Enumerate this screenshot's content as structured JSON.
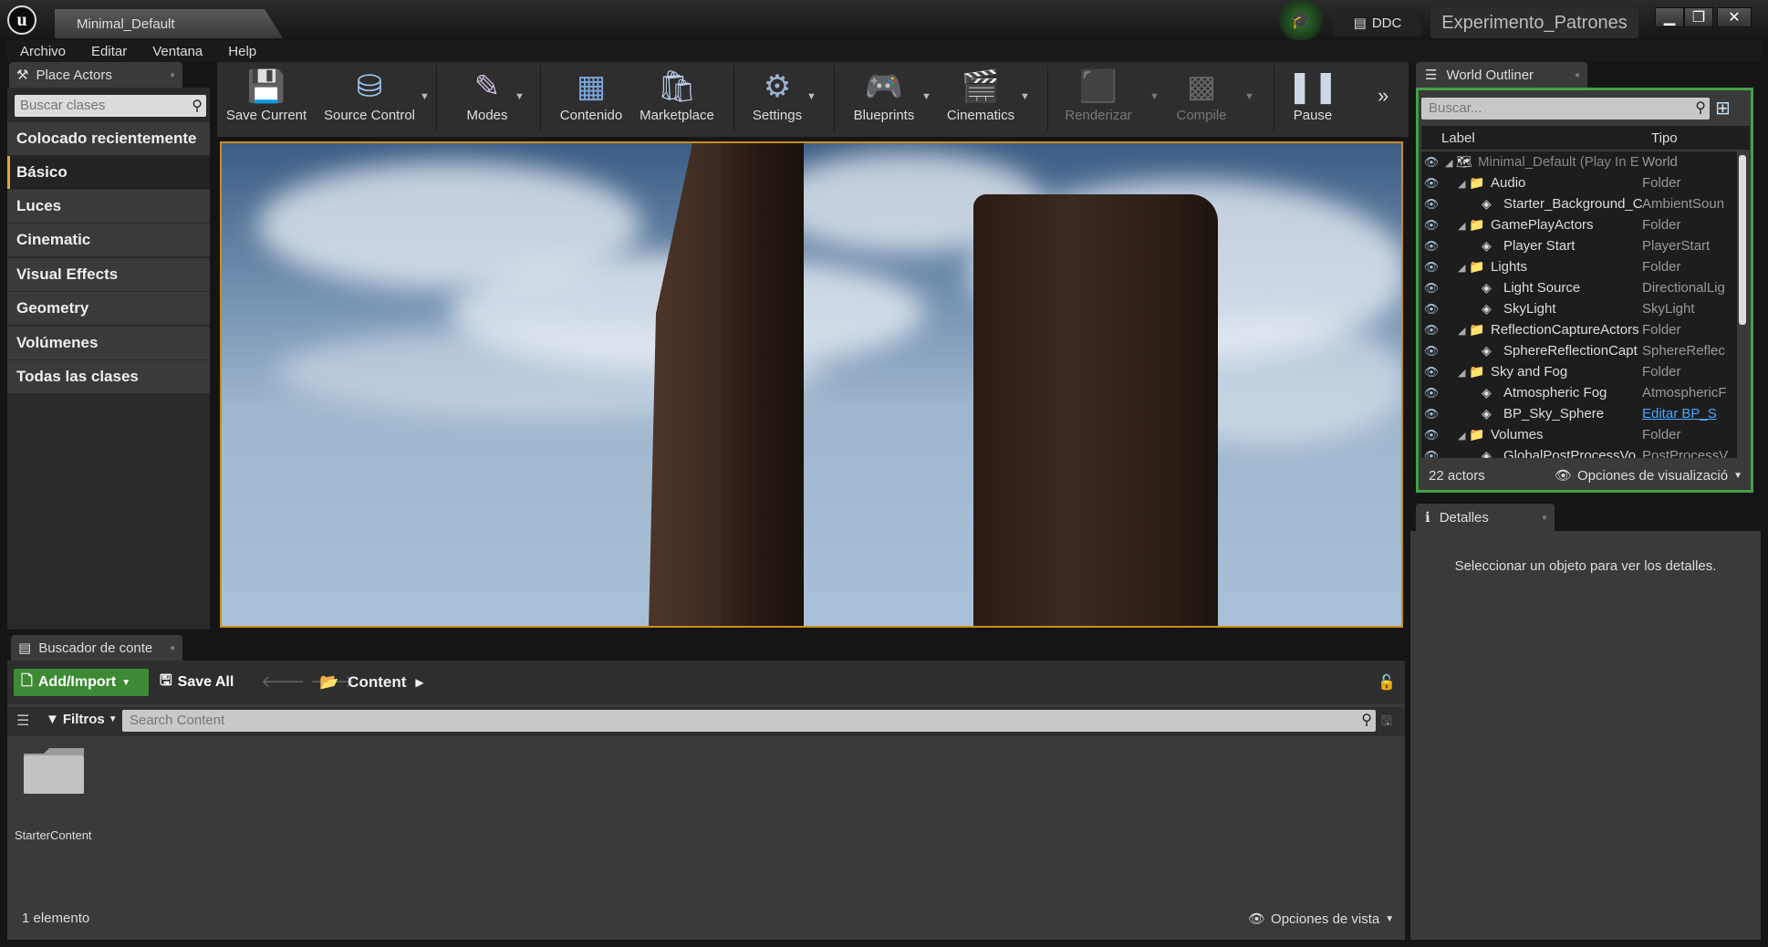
{
  "window": {
    "level_tab": "Minimal_Default",
    "ddc_label": "DDC",
    "project_name": "Experimento_Patrones",
    "tutorial_icon": "graduation-cap-icon"
  },
  "menu": [
    "Archivo",
    "Editar",
    "Ventana",
    "Help"
  ],
  "place_actors": {
    "tab_label": "Place Actors",
    "search_placeholder": "Buscar clases",
    "categories": [
      "Colocado recientemente",
      "Básico",
      "Luces",
      "Cinematic",
      "Visual Effects",
      "Geometry",
      "Volúmenes",
      "Todas las clases"
    ],
    "selected": "Básico"
  },
  "toolbar": [
    {
      "label": "Save Current",
      "icon": "save-icon",
      "enabled": true
    },
    {
      "label": "Source Control",
      "icon": "source-control-icon",
      "enabled": true
    },
    {
      "label": "Modes",
      "icon": "modes-icon",
      "enabled": true
    },
    {
      "label": "Contenido",
      "icon": "content-icon",
      "enabled": true
    },
    {
      "label": "Marketplace",
      "icon": "marketplace-icon",
      "enabled": true
    },
    {
      "label": "Settings",
      "icon": "settings-icon",
      "enabled": true
    },
    {
      "label": "Blueprints",
      "icon": "blueprints-icon",
      "enabled": true
    },
    {
      "label": "Cinematics",
      "icon": "cinematics-icon",
      "enabled": true
    },
    {
      "label": "Renderizar",
      "icon": "build-icon",
      "enabled": false
    },
    {
      "label": "Compile",
      "icon": "compile-icon",
      "enabled": false
    },
    {
      "label": "Pause",
      "icon": "pause-icon",
      "enabled": true
    }
  ],
  "content_browser": {
    "tab_label": "Buscador de conte",
    "add_import": "Add/Import",
    "save_all": "Save All",
    "path": "Content",
    "filters": "Filtros",
    "search_placeholder": "Search Content",
    "items": [
      {
        "name": "StarterContent",
        "icon": "folder-icon"
      }
    ],
    "count": "1 elemento",
    "view_options": "Opciones de vista"
  },
  "outliner": {
    "tab_label": "World Outliner",
    "search_placeholder": "Buscar...",
    "col_label": "Label",
    "col_type": "Tipo",
    "rows": [
      {
        "label": "Minimal_Default (Play In E",
        "type": "World",
        "depth": 0,
        "folder": false
      },
      {
        "label": "Audio",
        "type": "Folder",
        "depth": 1,
        "folder": true
      },
      {
        "label": "Starter_Background_C",
        "type": "AmbientSoun",
        "depth": 2,
        "folder": false
      },
      {
        "label": "GamePlayActors",
        "type": "Folder",
        "depth": 1,
        "folder": true
      },
      {
        "label": "Player Start",
        "type": "PlayerStart",
        "depth": 2,
        "folder": false
      },
      {
        "label": "Lights",
        "type": "Folder",
        "depth": 1,
        "folder": true
      },
      {
        "label": "Light Source",
        "type": "DirectionalLig",
        "depth": 2,
        "folder": false
      },
      {
        "label": "SkyLight",
        "type": "SkyLight",
        "depth": 2,
        "folder": false
      },
      {
        "label": "ReflectionCaptureActors",
        "type": "Folder",
        "depth": 1,
        "folder": true
      },
      {
        "label": "SphereReflectionCapt",
        "type": "SphereReflec",
        "depth": 2,
        "folder": false
      },
      {
        "label": "Sky and Fog",
        "type": "Folder",
        "depth": 1,
        "folder": true
      },
      {
        "label": "Atmospheric Fog",
        "type": "AtmosphericF",
        "depth": 2,
        "folder": false
      },
      {
        "label": "BP_Sky_Sphere",
        "type": "Editar BP_S",
        "depth": 2,
        "folder": false,
        "link": true
      },
      {
        "label": "Volumes",
        "type": "Folder",
        "depth": 1,
        "folder": true
      },
      {
        "label": "GlobalPostProcessVo",
        "type": "PostProcessV",
        "depth": 2,
        "folder": false
      }
    ],
    "actor_count": "22 actors",
    "view_options": "Opciones de visualizació"
  },
  "details": {
    "tab_label": "Detalles",
    "empty_message": "Seleccionar un objeto para ver los detalles."
  }
}
